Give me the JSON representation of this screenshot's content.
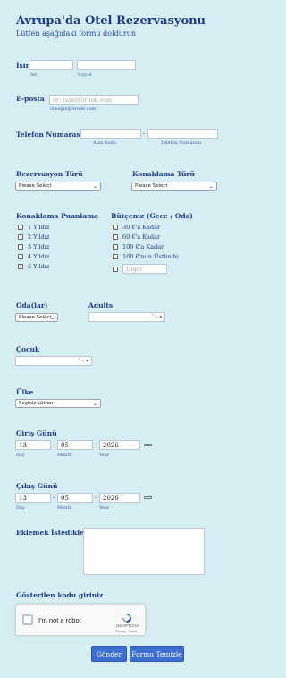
{
  "header": {
    "title": "Avrupa'da Otel Rezervasyonu",
    "subtitle": "Lütfen aşağıdaki formu doldurun"
  },
  "name": {
    "label": "İsim",
    "first_sub": "Ad",
    "last_sub": "Soyad"
  },
  "email": {
    "label": "E-posta",
    "placeholder": "ör: isim@örnek.com",
    "sub": "örneğin@örnek.com"
  },
  "phone": {
    "label": "Telefon Numarası",
    "separator": "-",
    "area_sub": "Alan Kodu",
    "number_sub": "Telefon Numarası"
  },
  "reservation_type": {
    "label": "Rezervasyon Türü",
    "selected": "Please Select"
  },
  "accommodation_type": {
    "label": "Konaklama Türü",
    "selected": "Please Select"
  },
  "rating": {
    "label": "Konaklama Puanlama",
    "options": [
      "1 Yıldız",
      "2 Yıldız",
      "3 Yıldız",
      "4 Yıldız",
      "5 Yıldız"
    ]
  },
  "budget": {
    "label": "Bütçeniz (Gece / Oda)",
    "options": [
      "30 €'a Kadar",
      "60 €'a Kadar",
      "100 €'a Kadar",
      "100 €'nun Üstünde"
    ],
    "other_placeholder": "Diğer"
  },
  "rooms": {
    "label": "Oda(lar)",
    "selected": "Please Select"
  },
  "adults": {
    "label": "Adults"
  },
  "children": {
    "label": "Çocuk"
  },
  "country": {
    "label": "Ülke",
    "selected": "Seçiniz Lütfen"
  },
  "checkin": {
    "label": "Giriş Günü",
    "day": "13",
    "month": "05",
    "year": "2026",
    "day_sub": "Day",
    "month_sub": "Month",
    "year_sub": "Year"
  },
  "checkout": {
    "label": "Çıkış Günü",
    "day": "13",
    "month": "05",
    "year": "2026",
    "day_sub": "Day",
    "month_sub": "Month",
    "year_sub": "Year"
  },
  "notes": {
    "label": "Eklemek İstedikleriniz"
  },
  "captcha": {
    "label": "Gösterilen kodu giriniz",
    "checkbox_text": "I'm not a robot",
    "brand": "reCAPTCHA",
    "links": "Privacy - Terms"
  },
  "actions": {
    "submit": "Gönder",
    "reset": "Formu Temizle"
  },
  "colors": {
    "background": "#d6edf3",
    "text": "#1d3a8a",
    "button": "#3d6fd0"
  }
}
